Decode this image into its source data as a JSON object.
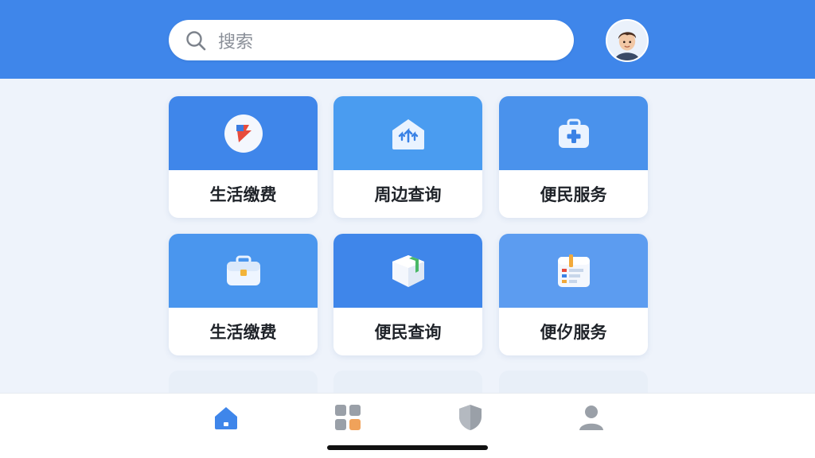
{
  "header": {
    "search": {
      "placeholder": "搜索"
    }
  },
  "colors": {
    "header_bg": "#3f86ea",
    "page_bg": "#eef3fb",
    "card_top_1": "#3f86ea",
    "card_top_2": "#4a9cf0",
    "tab_active": "#3f86ea",
    "tab_inactive": "#9aa0a8"
  },
  "grid": {
    "items": [
      {
        "label": "生活缴费",
        "icon": "payment-flag-icon"
      },
      {
        "label": "周边查询",
        "icon": "nearby-house-icon"
      },
      {
        "label": "便民服务",
        "icon": "medical-kit-icon"
      },
      {
        "label": "生活缴费",
        "icon": "briefcase-icon"
      },
      {
        "label": "便民查询",
        "icon": "package-box-icon"
      },
      {
        "label": "便㐴服务",
        "icon": "calendar-list-icon"
      }
    ]
  },
  "tabbar": {
    "tabs": [
      {
        "icon": "home-icon",
        "active": true
      },
      {
        "icon": "apps-grid-icon",
        "active": false
      },
      {
        "icon": "shield-icon",
        "active": false
      },
      {
        "icon": "user-icon",
        "active": false
      }
    ]
  }
}
